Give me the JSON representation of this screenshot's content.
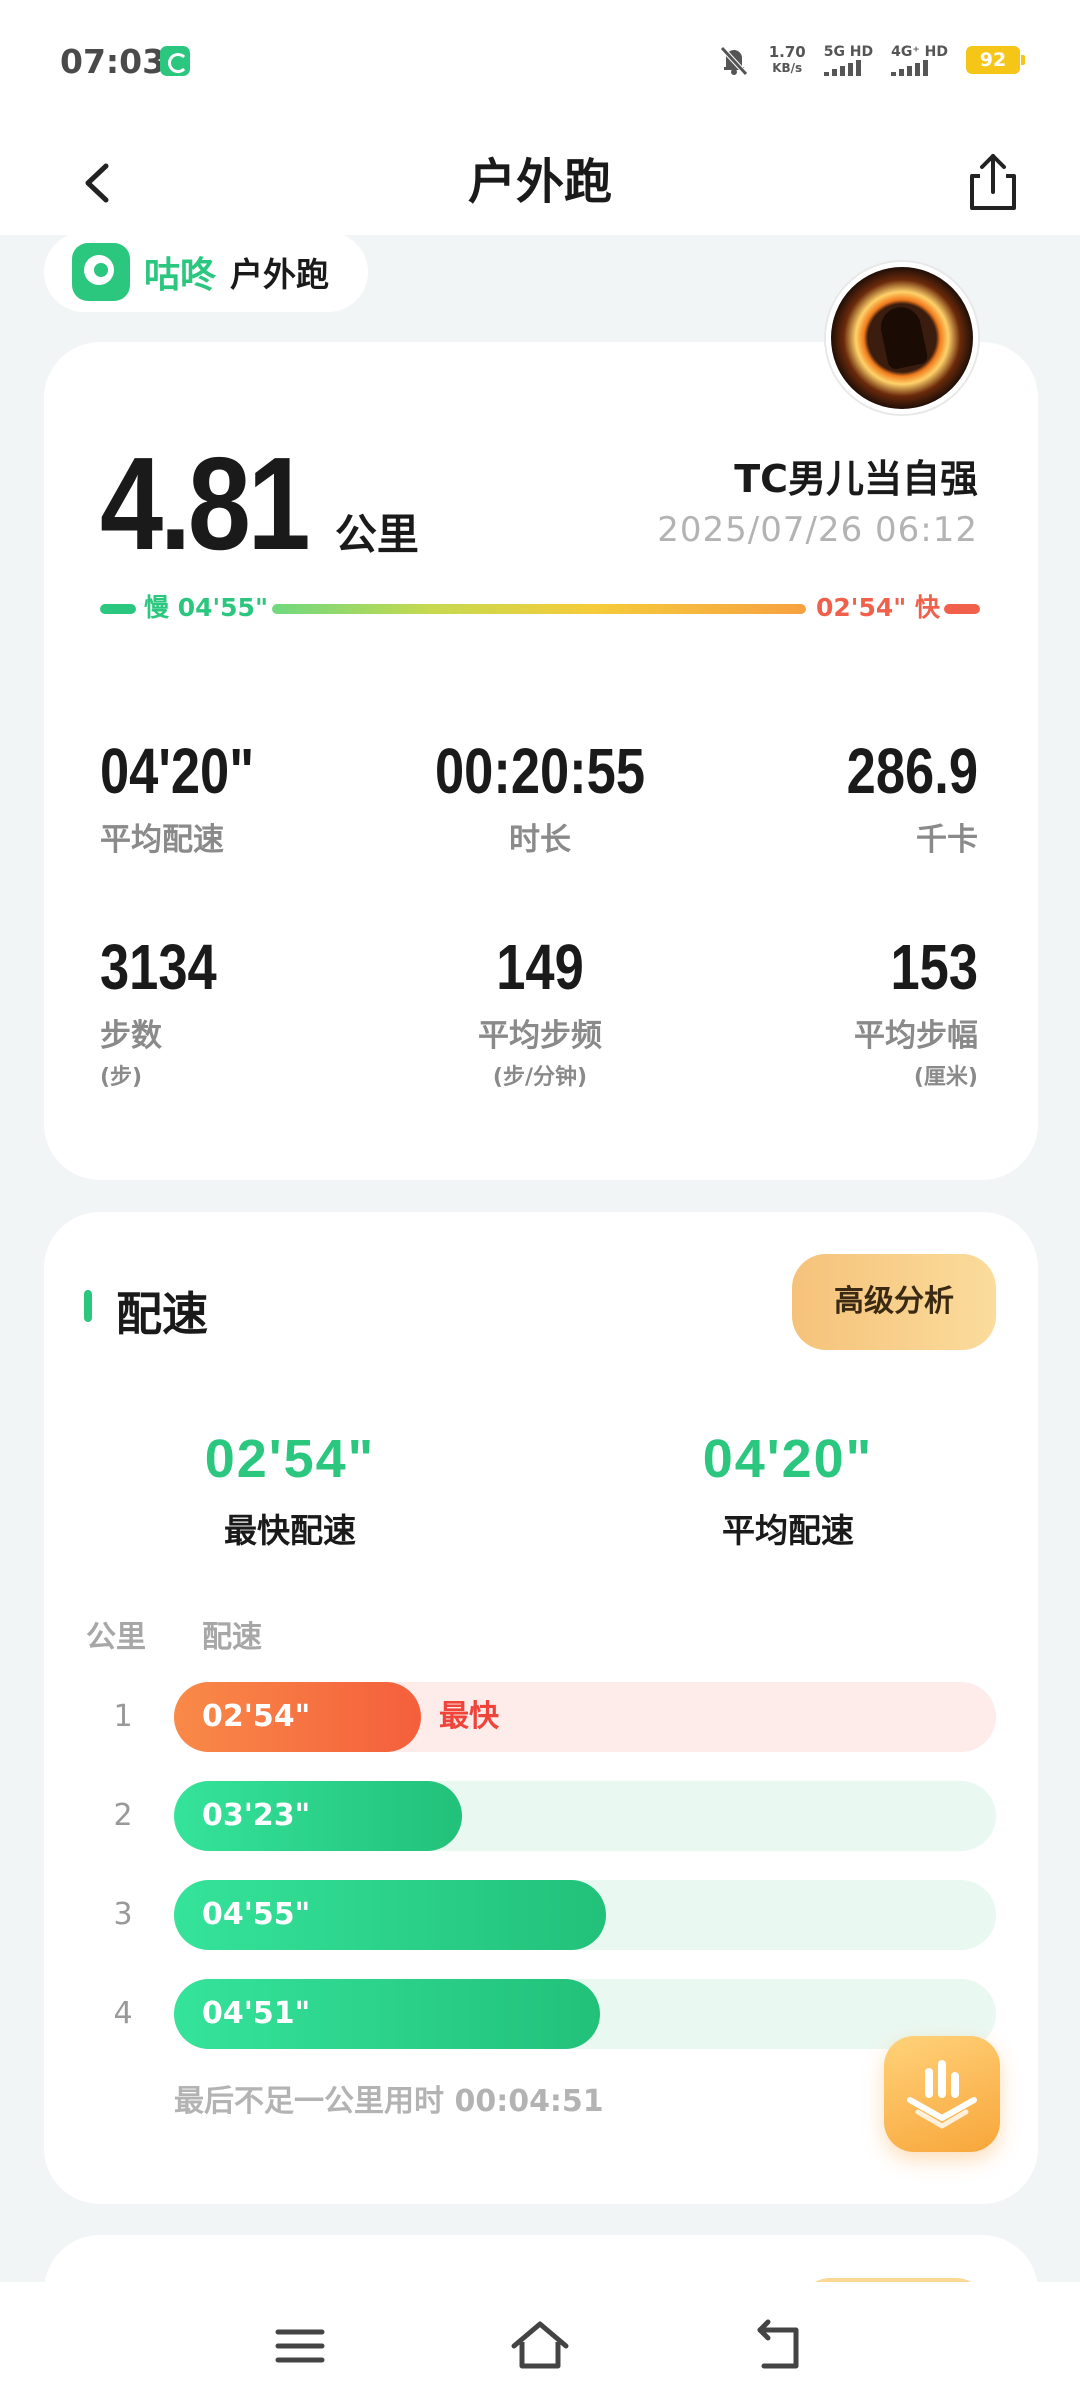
{
  "status_bar": {
    "time": "07:03",
    "net_speed_value": "1.70",
    "net_speed_unit": "KB/s",
    "sim1": "5G HD",
    "sim2": "4G⁺ HD",
    "battery": "92"
  },
  "header": {
    "title": "户外跑"
  },
  "brand": {
    "name": "咕咚",
    "activity": "户外跑"
  },
  "summary": {
    "distance": "4.81",
    "distance_unit": "公里",
    "user_name": "TC男儿当自强",
    "date": "2025/07/26 06:12",
    "pace_scale": {
      "slow_label": "慢 04'55\"",
      "fast_label": "02'54\" 快"
    },
    "stats": [
      {
        "value": "04'20\"",
        "label": "平均配速",
        "sub": ""
      },
      {
        "value": "00:20:55",
        "label": "时长",
        "sub": ""
      },
      {
        "value": "286.9",
        "label": "千卡",
        "sub": ""
      },
      {
        "value": "3134",
        "label": "步数",
        "sub": "(步)"
      },
      {
        "value": "149",
        "label": "平均步频",
        "sub": "(步/分钟)"
      },
      {
        "value": "153",
        "label": "平均步幅",
        "sub": "(厘米)"
      }
    ]
  },
  "pace": {
    "title": "配速",
    "advanced_button": "高级分析",
    "fastest_value": "02'54\"",
    "fastest_label": "最快配速",
    "average_value": "04'20\"",
    "average_label": "平均配速",
    "col_km": "公里",
    "col_pace": "配速",
    "splits": [
      {
        "km": "1",
        "pace": "02'54\"",
        "fill": 0.3,
        "fastest": true,
        "tag": "最快"
      },
      {
        "km": "2",
        "pace": "03'23\"",
        "fill": 0.35,
        "fastest": false,
        "tag": ""
      },
      {
        "km": "3",
        "pace": "04'55\"",
        "fill": 0.525,
        "fastest": false,
        "tag": ""
      },
      {
        "km": "4",
        "pace": "04'51\"",
        "fill": 0.518,
        "fastest": false,
        "tag": ""
      }
    ],
    "last_note": "最后不足一公里用时 00:04:51"
  },
  "colors": {
    "accent": "#2bc77f",
    "fast": "#f0604a",
    "background": "#f2f5f5"
  },
  "icons": {
    "back": "back-icon",
    "share": "share-icon",
    "mute": "mute-bell-icon",
    "menu": "menu-icon",
    "home": "home-icon",
    "sys_back": "back-arrow-icon"
  }
}
